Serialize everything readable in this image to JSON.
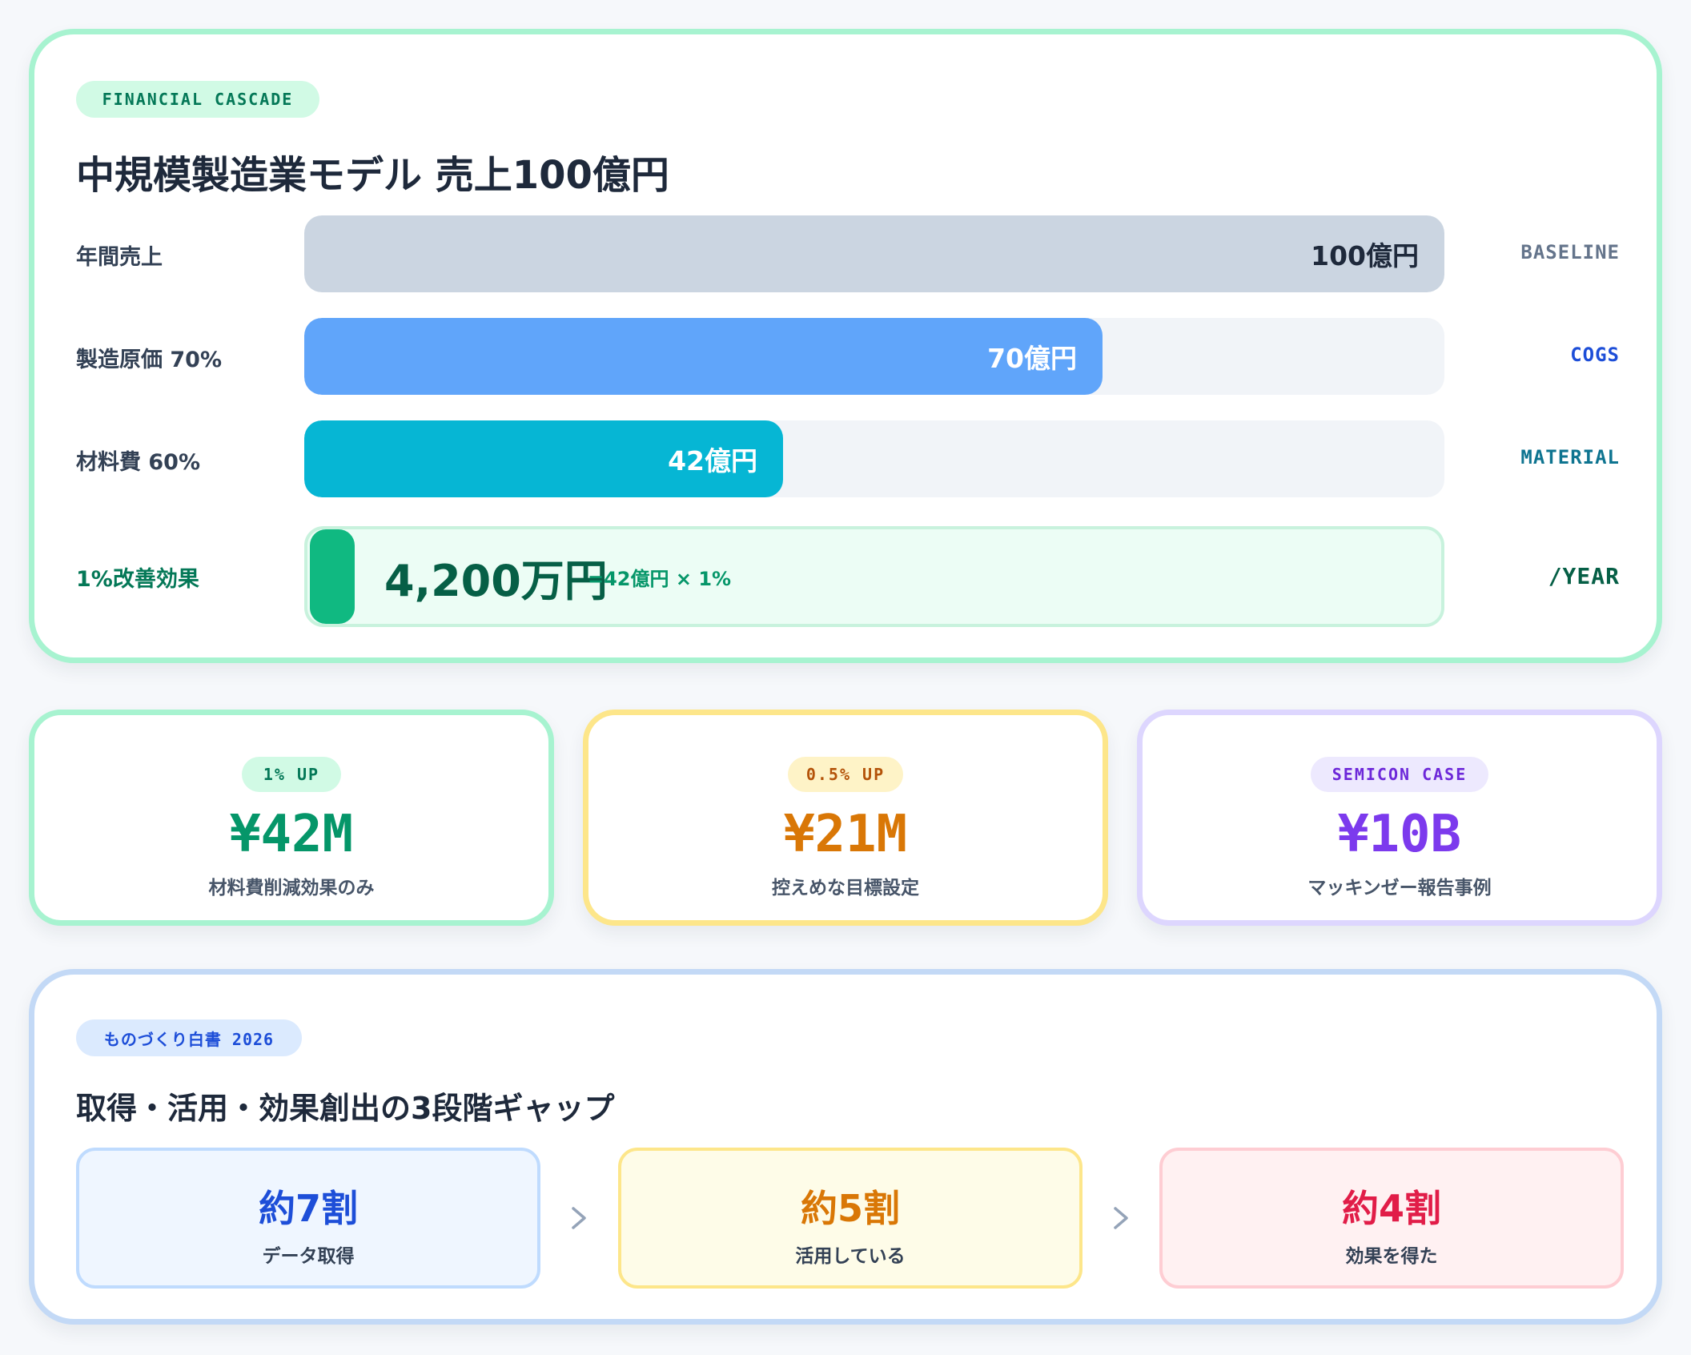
{
  "cascade": {
    "tag": "FINANCIAL CASCADE",
    "title": "中規模製造業モデル 売上100億円",
    "effect": {
      "label": "1%改善効果",
      "value": "4,200万円",
      "formula": "=42億円 × 1%",
      "tag": "/YEAR",
      "value_oku": 0.42
    }
  },
  "chart_data": {
    "type": "bar",
    "orientation": "horizontal",
    "categories": [
      "年間売上",
      "製造原価 70%",
      "材料費 60%"
    ],
    "values": [
      100,
      70,
      42
    ],
    "value_labels": [
      "100億円",
      "70億円",
      "42億円"
    ],
    "tags": [
      "BASELINE",
      "COGS",
      "MATERIAL"
    ],
    "xlim": [
      0,
      100
    ],
    "colors": [
      "#cbd5e1",
      "#60a5fa",
      "#06b6d4"
    ],
    "label_colors": [
      "#1e293b",
      "#ffffff",
      "#ffffff"
    ],
    "tag_colors": [
      "#64748b",
      "#1d4ed8",
      "#0e7490"
    ]
  },
  "stats": [
    {
      "badge": "1% UP",
      "value": "¥42M",
      "desc": "材料費削減効果のみ",
      "accent": "#059669",
      "border": "#a7f3d0",
      "badge_bg": "#d1fae5",
      "badge_fg": "#047857"
    },
    {
      "badge": "0.5% UP",
      "value": "¥21M",
      "desc": "控えめな目標設定",
      "accent": "#d97706",
      "border": "#fde68a",
      "badge_bg": "#fef3c7",
      "badge_fg": "#b45309"
    },
    {
      "badge": "SEMICON CASE",
      "value": "¥10B",
      "desc": "マッキンゼー報告事例",
      "accent": "#7c3aed",
      "border": "#ddd6fe",
      "badge_bg": "#ede9fe",
      "badge_fg": "#6d28d9"
    }
  ],
  "gap": {
    "tag": "ものづくり白書 2026",
    "title": "取得・活用・効果創出の3段階ギャップ",
    "steps": [
      {
        "value": "約7割",
        "label": "データ取得",
        "accent": "#1d4ed8",
        "bg": "#eff6ff",
        "border": "#bfdbfe"
      },
      {
        "value": "約5割",
        "label": "活用している",
        "accent": "#d97706",
        "bg": "#fefce8",
        "border": "#fde68a"
      },
      {
        "value": "約4割",
        "label": "効果を得た",
        "accent": "#e11d48",
        "bg": "#fff1f2",
        "border": "#fecdd3"
      }
    ]
  }
}
